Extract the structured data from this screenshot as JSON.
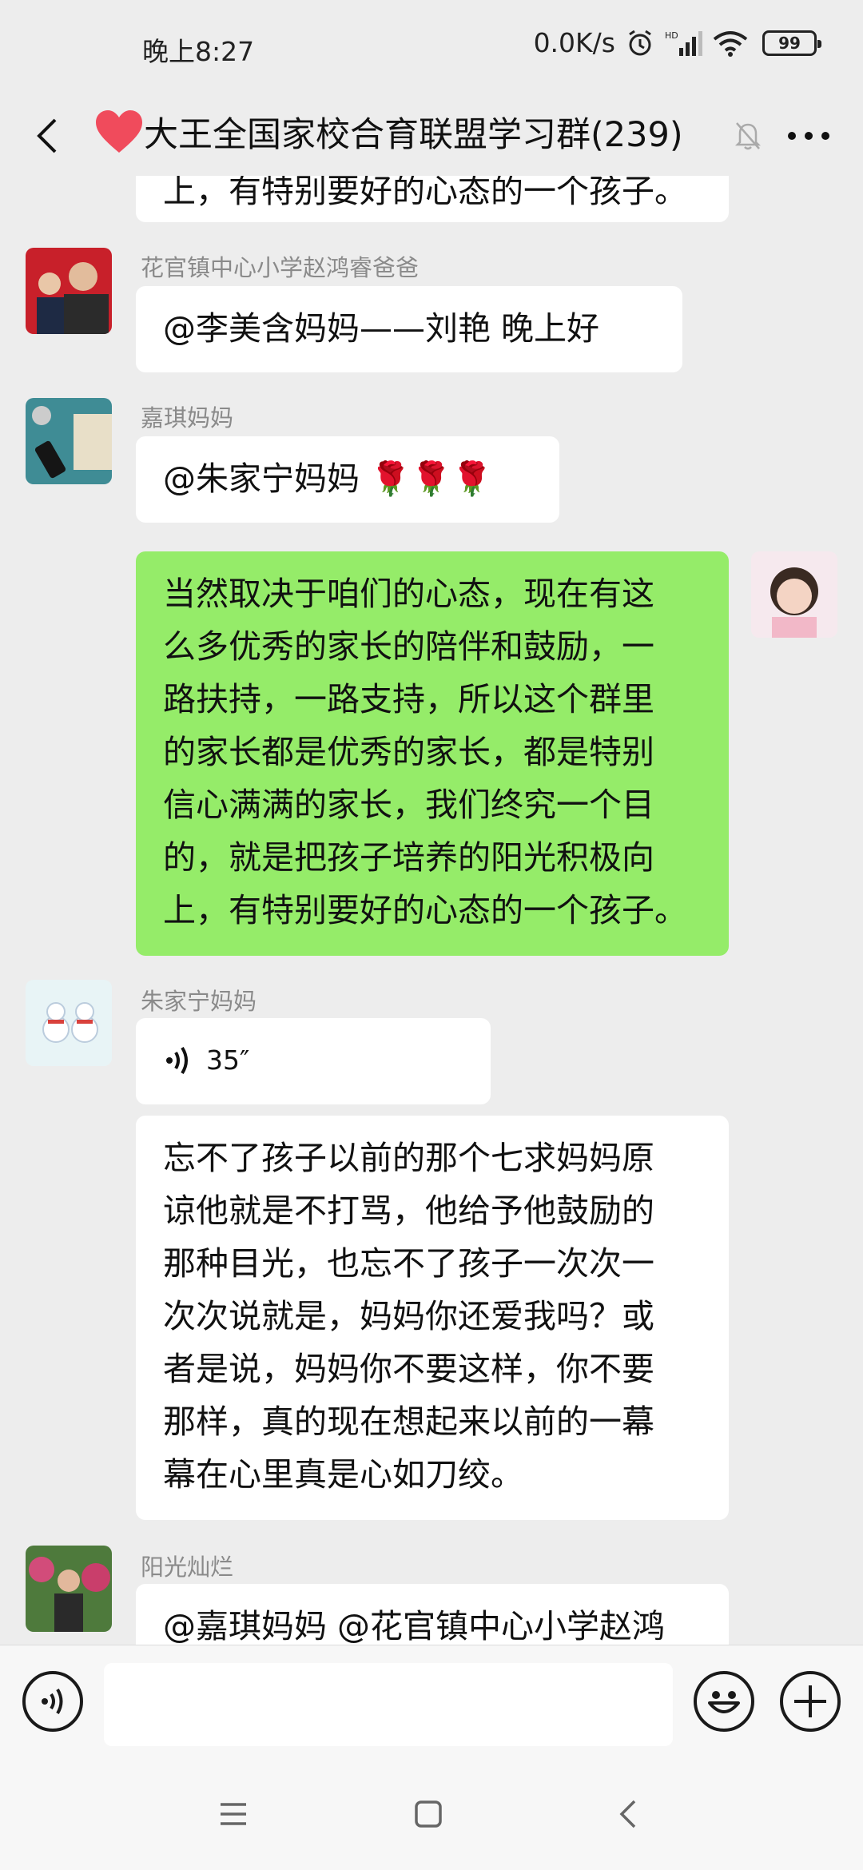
{
  "status_bar": {
    "time": "晚上8:27",
    "net_speed": "0.0K/s",
    "battery": "99"
  },
  "header": {
    "title": "大王全国家校合育联盟学习群(239)"
  },
  "messages": [
    {
      "partial_text": "上，有特别要好的心态的一个孩子。"
    },
    {
      "sender": "花官镇中心小学赵鸿睿爸爸",
      "text": "@李美含妈妈——刘艳  晚上好"
    },
    {
      "sender": "嘉琪妈妈",
      "text": "@朱家宁妈妈 🌹🌹🌹"
    },
    {
      "text": "当然取决于咱们的心态，现在有这\n么多优秀的家长的陪伴和鼓励，一\n路扶持，一路支持，所以这个群里\n的家长都是优秀的家长，都是特别\n信心满满的家长，我们终究一个目\n的，就是把孩子培养的阳光积极向\n上，有特别要好的心态的一个孩子。"
    },
    {
      "sender": "朱家宁妈妈",
      "voice_duration": "35″",
      "text": "忘不了孩子以前的那个七求妈妈原\n谅他就是不打骂，他给予他鼓励的\n那种目光，也忘不了孩子一次次一\n次次说就是，妈妈你还爱我吗？或\n者是说，妈妈你不要这样，你不要\n那样，真的现在想起来以前的一幕\n幕在心里真是心如刀绞。"
    },
    {
      "sender": "阳光灿烂",
      "text": "@嘉琪妈妈 @花官镇中心小学赵鸿"
    }
  ],
  "input": {
    "placeholder": ""
  },
  "colors": {
    "mine_bubble": "#95EC69",
    "other_bubble": "#FFFFFF",
    "background": "#EDEDED",
    "heart": "#F04B5C"
  },
  "icons": [
    "back-chevron-icon",
    "heart-icon",
    "mute-bell-icon",
    "more-dots-icon",
    "voice-wave-icon",
    "emoji-icon",
    "plus-icon",
    "menu-icon",
    "home-square-icon",
    "back-triangle-icon"
  ]
}
